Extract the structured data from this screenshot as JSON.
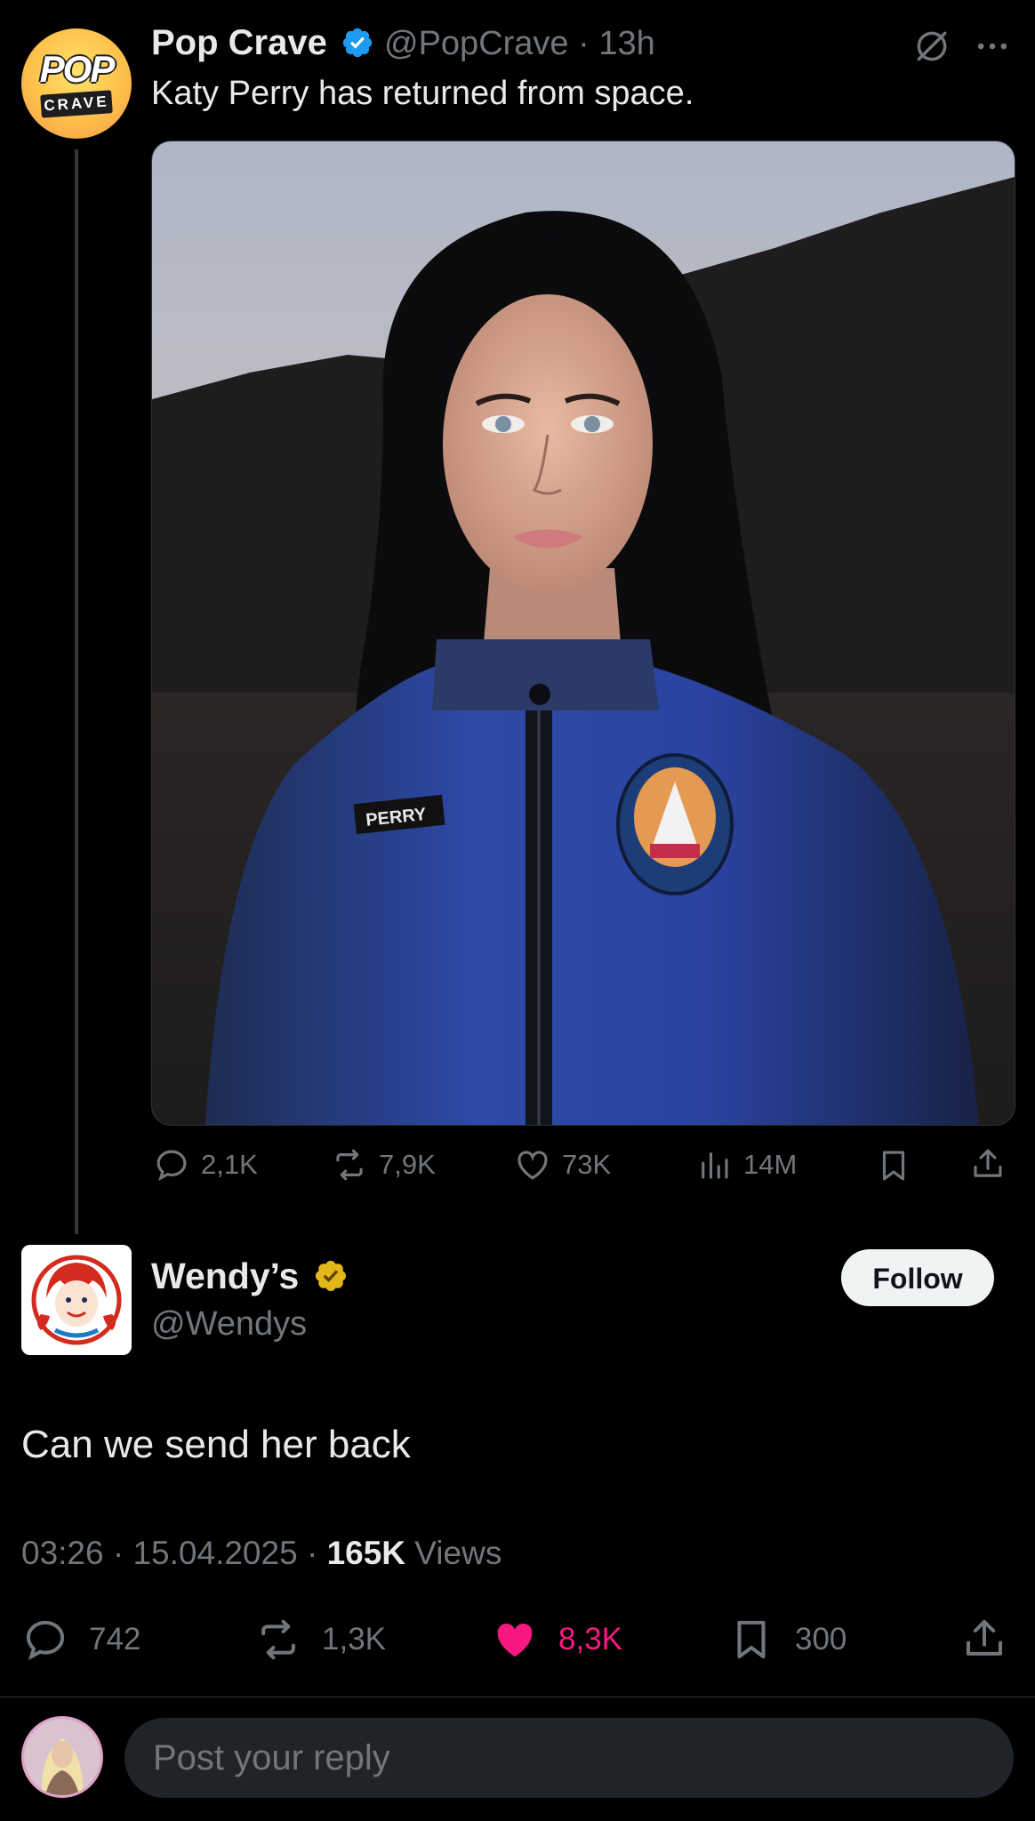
{
  "parent_tweet": {
    "avatar_text_top": "POP",
    "avatar_text_bottom": "CRAVE",
    "name": "Pop Crave",
    "handle": "@PopCrave",
    "age": "13h",
    "text": "Katy Perry has returned from space.",
    "photo_patch": "PERRY",
    "actions": {
      "replies": "2,1K",
      "reposts": "7,9K",
      "likes": "73K",
      "views": "14M"
    }
  },
  "reply_tweet": {
    "name": "Wendy’s",
    "handle": "@Wendys",
    "follow_label": "Follow",
    "text": "Can we send her back",
    "time": "03:26",
    "date": "15.04.2025",
    "views_count": "165K",
    "views_label": "Views",
    "actions": {
      "replies": "742",
      "reposts": "1,3K",
      "likes": "8,3K",
      "bookmarks": "300"
    }
  },
  "composer": {
    "placeholder": "Post your reply"
  },
  "colors": {
    "background": "#000000",
    "text": "#e7e9ea",
    "muted": "#71767b",
    "verified_blue": "#1d9bf0",
    "verified_gold": "#e2b719",
    "like_pink": "#f91880"
  },
  "icons": [
    "verified-badge-icon",
    "grok-icon",
    "more-icon",
    "reply-icon",
    "repost-icon",
    "like-icon",
    "views-icon",
    "bookmark-icon",
    "share-icon"
  ]
}
